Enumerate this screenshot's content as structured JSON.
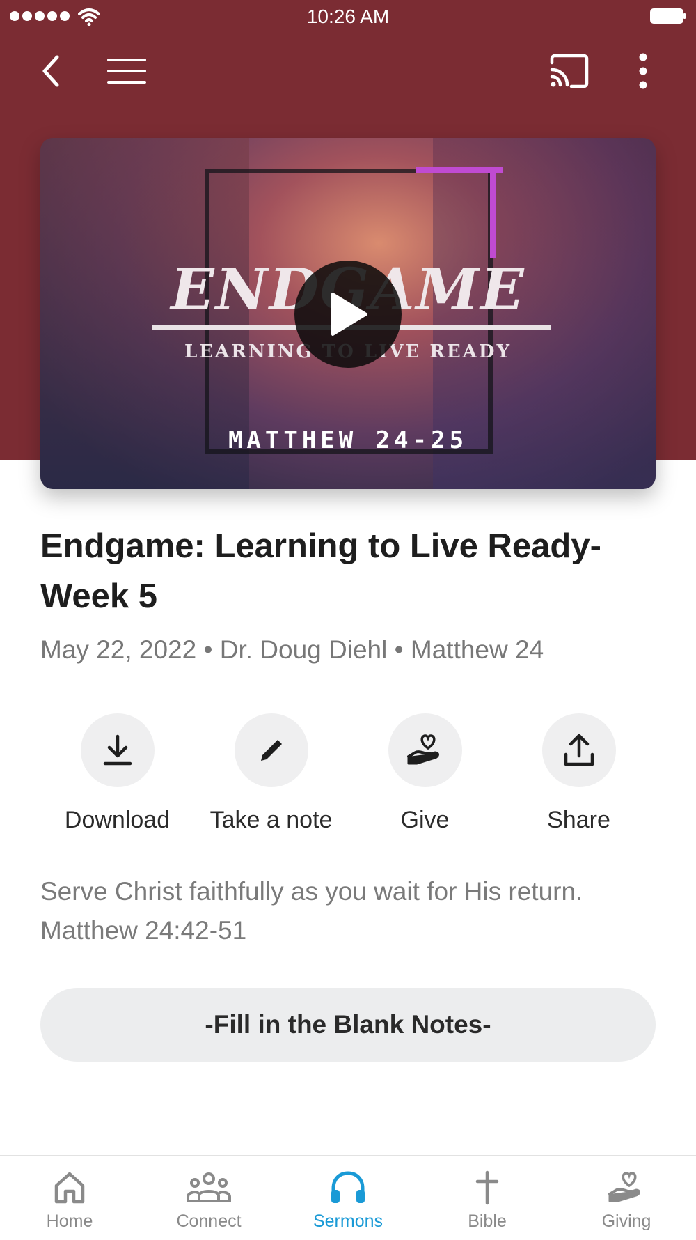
{
  "status_bar": {
    "time": "10:26 AM"
  },
  "colors": {
    "header_bg": "#7b2c33",
    "accent": "#1a9ad6",
    "tab_inactive": "#8a8a8a"
  },
  "nav": {
    "back_icon": "chevron-left-icon",
    "menu_icon": "hamburger-icon",
    "cast_icon": "cast-icon",
    "more_icon": "more-vertical-icon"
  },
  "video": {
    "title": "ENDGAME",
    "subtitle": "LEARNING TO LIVE READY",
    "reference": "MATTHEW 24-25",
    "play_icon": "play-icon"
  },
  "sermon": {
    "title": "Endgame: Learning to Live Ready- Week 5",
    "date": "May 22, 2022",
    "speaker": "Dr. Doug Diehl",
    "passage": "Matthew 24",
    "separator": "•",
    "description_line1": "Serve Christ faithfully as you wait for His return.",
    "description_line2": "Matthew 24:42-51"
  },
  "actions": [
    {
      "label": "Download",
      "icon": "download-icon"
    },
    {
      "label": "Take a note",
      "icon": "pencil-icon"
    },
    {
      "label": "Give",
      "icon": "giving-hand-heart-icon"
    },
    {
      "label": "Share",
      "icon": "share-icon"
    }
  ],
  "notes_button": {
    "label": "-Fill in the Blank Notes-"
  },
  "tabs": [
    {
      "label": "Home",
      "icon": "home-icon",
      "active": false
    },
    {
      "label": "Connect",
      "icon": "people-icon",
      "active": false
    },
    {
      "label": "Sermons",
      "icon": "headphones-icon",
      "active": true
    },
    {
      "label": "Bible",
      "icon": "cross-icon",
      "active": false
    },
    {
      "label": "Giving",
      "icon": "giving-hand-heart-icon",
      "active": false
    }
  ]
}
